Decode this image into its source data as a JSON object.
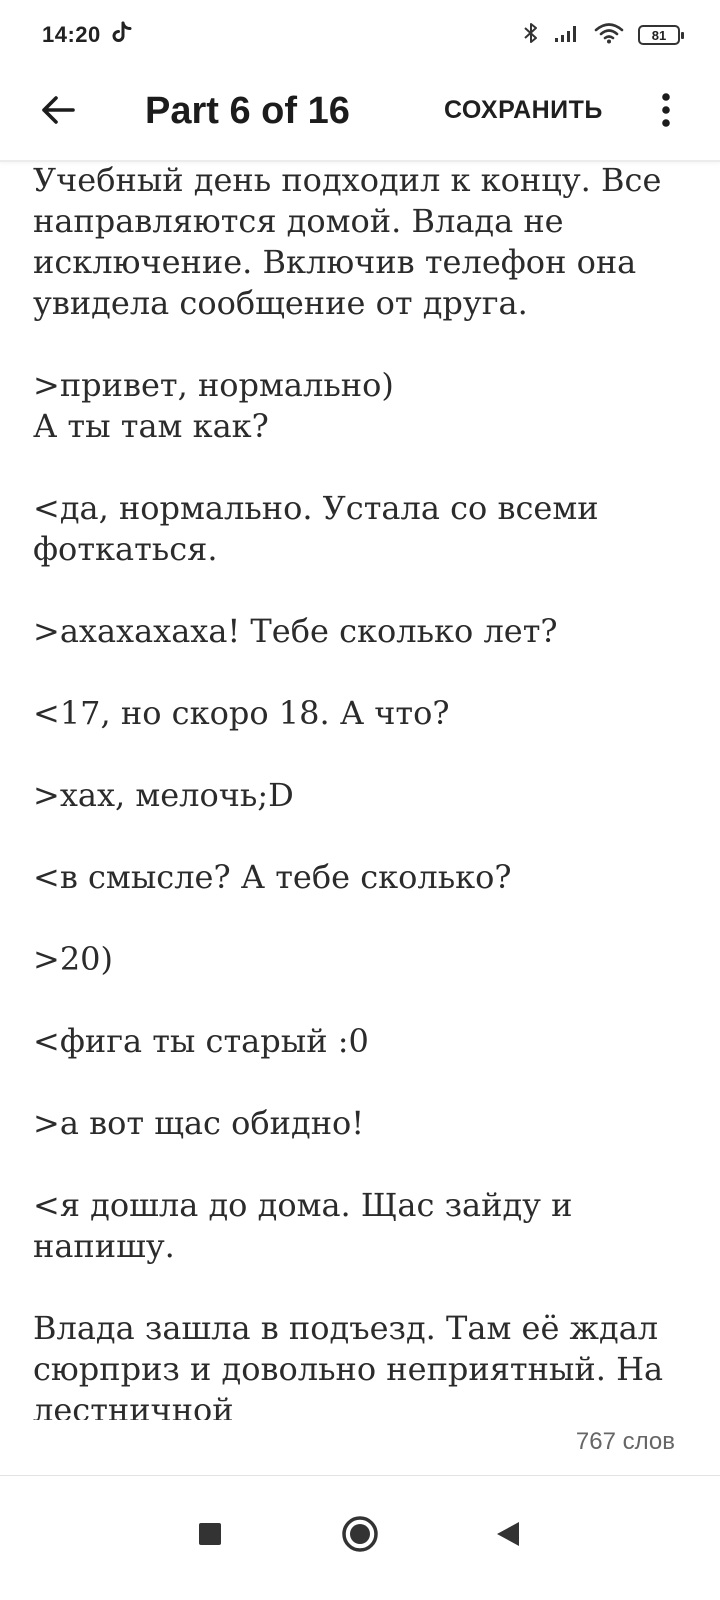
{
  "status_bar": {
    "time": "14:20",
    "battery_level": "81",
    "icons": [
      "tiktok-icon",
      "bluetooth-icon",
      "signal-icon",
      "wifi-icon",
      "battery-icon"
    ]
  },
  "app_bar": {
    "back_icon": "arrow-back-icon",
    "title": "Part 6 of 16",
    "save_label": "СОХРАНИТЬ",
    "more_icon": "more-vert-icon"
  },
  "content": {
    "paragraphs": [
      "Учебный день подходил к концу. Все направляются домой. Влада не исключение. Включив телефон она увидела сообщение от друга.",
      ">привет, нормально)\nА ты там как?",
      "<да, нормально. Устала со всеми фоткаться.",
      ">ахахахаха! Тебе сколько лет?",
      "<17, но скоро 18. А что?",
      ">хах, мелочь;D",
      "<в смысле? А тебе сколько?",
      ">20)",
      "<фига ты старый :0",
      ">а вот щас обидно!",
      "<я дошла до дома. Щас зайду и напишу.",
      "Влада зашла в подъезд. Там её ждал сюрприз и довольно неприятный. На лестничной"
    ]
  },
  "footer": {
    "word_count": "767 слов"
  },
  "nav_bar": {
    "icons": [
      "recents-square-icon",
      "home-circle-icon",
      "back-triangle-icon"
    ]
  },
  "colors": {
    "background": "#ffffff",
    "text": "#2b2b2b",
    "muted": "#666666",
    "divider": "#ececec"
  }
}
